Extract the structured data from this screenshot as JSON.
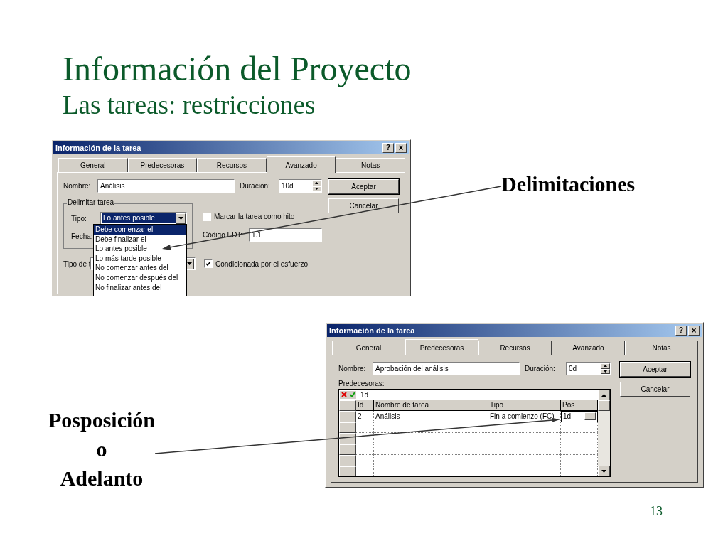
{
  "slide": {
    "title": "Información del Proyecto",
    "subtitle": "Las tareas: restricciones",
    "page_number": "13"
  },
  "callout_top": {
    "text": "Delimitaciones"
  },
  "callout_bottom": {
    "lines": [
      "Posposición",
      "o",
      "Adelanto"
    ]
  },
  "dialog_1": {
    "title": "Información de la tarea",
    "help": "?",
    "close": "×",
    "tabs": [
      {
        "label": "General",
        "selected": false
      },
      {
        "label": "Predecesoras",
        "selected": false
      },
      {
        "label": "Recursos",
        "selected": false
      },
      {
        "label": "Avanzado",
        "selected": true
      },
      {
        "label": "Notas",
        "selected": false
      }
    ],
    "name_label": "Nombre:",
    "name_value": "Análisis",
    "duration_label": "Duración:",
    "duration_value": "10d",
    "buttons": [
      "Aceptar",
      "Cancelar"
    ],
    "group_title": "Delimitar tarea",
    "type_label": "Tipo:",
    "type_value": "Lo antes posible",
    "date_label": "Fecha:",
    "dropdown_items": [
      {
        "label": "Debe comenzar el",
        "selected": true
      },
      {
        "label": "Debe finalizar el",
        "selected": false
      },
      {
        "label": "Lo antes posible",
        "selected": false
      },
      {
        "label": "Lo más tarde posible",
        "selected": false
      },
      {
        "label": "No comenzar antes del",
        "selected": false
      },
      {
        "label": "No comenzar después del",
        "selected": false
      },
      {
        "label": "No finalizar antes del",
        "selected": false
      }
    ],
    "milestone": {
      "label": "Marcar la tarea como hito",
      "checked": false
    },
    "wbs_label": "Código EDT:",
    "wbs_value": "1.1",
    "task_type_label": "Tipo de t",
    "effort": {
      "label": "Condicionada por el esfuerzo",
      "checked": true
    }
  },
  "dialog_2": {
    "title": "Información de la tarea",
    "help": "?",
    "close": "×",
    "tabs": [
      {
        "label": "General",
        "selected": false
      },
      {
        "label": "Predecesoras",
        "selected": true
      },
      {
        "label": "Recursos",
        "selected": false
      },
      {
        "label": "Avanzado",
        "selected": false
      },
      {
        "label": "Notas",
        "selected": false
      }
    ],
    "name_label": "Nombre:",
    "name_value": "Aprobación del análisis",
    "duration_label": "Duración:",
    "duration_value": "0d",
    "buttons": [
      "Aceptar",
      "Cancelar"
    ],
    "predecessors_label": "Predecesoras:",
    "entry_value": "1d",
    "columns": [
      "Id",
      "Nombre de tarea",
      "Tipo",
      "Pos"
    ],
    "rows": [
      [
        "2",
        "Análisis",
        "Fin a comienzo (FC)",
        "1d"
      ]
    ]
  }
}
